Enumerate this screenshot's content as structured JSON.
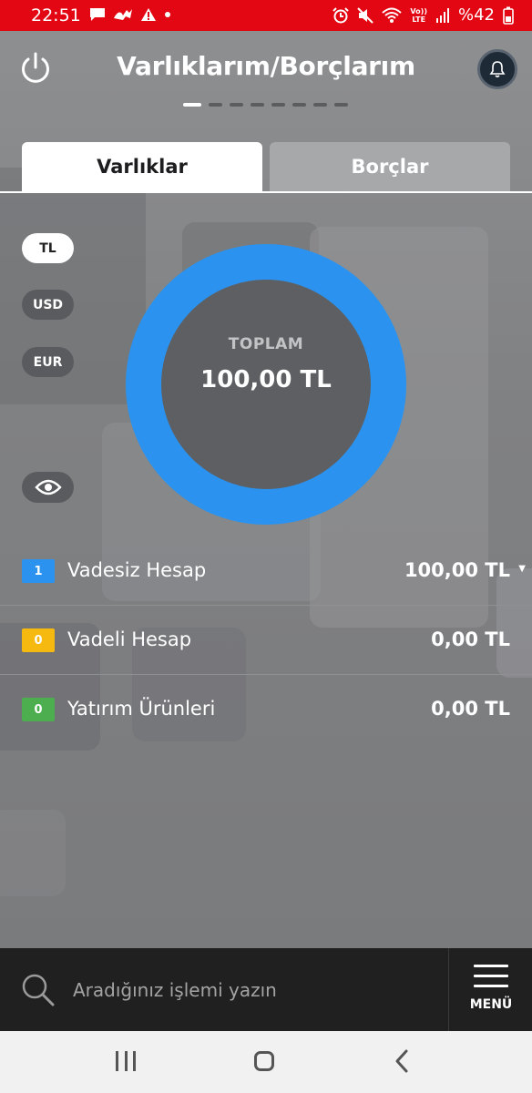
{
  "status_bar": {
    "time": "22:51",
    "battery": "%42",
    "left_icons": [
      "message-icon",
      "animal-icon",
      "warning-icon",
      "dot-icon"
    ],
    "right_icons": [
      "alarm-icon",
      "mute-icon",
      "wifi-icon",
      "volte-icon",
      "signal-icon",
      "battery-icon"
    ],
    "volte_top": "Vo))",
    "volte_bottom": "LTE",
    "color": "#e30613"
  },
  "header": {
    "title": "Varlıklarım/Borçlarım",
    "power_icon": "power-icon",
    "bell_icon": "bell-icon",
    "page_dots_count": 8,
    "active_dot": 0
  },
  "tabs": [
    {
      "label": "Varlıklar",
      "active": true
    },
    {
      "label": "Borçlar",
      "active": false
    }
  ],
  "currencies": [
    {
      "label": "TL",
      "selected": true
    },
    {
      "label": "USD",
      "selected": false
    },
    {
      "label": "EUR",
      "selected": false
    }
  ],
  "visibility_toggle": {
    "icon": "eye-icon"
  },
  "summary": {
    "label": "TOPLAM",
    "value": "100,00 TL",
    "ring_color": "#2b93ef"
  },
  "accounts": [
    {
      "count": "1",
      "name": "Vadesiz Hesap",
      "amount": "100,00 TL",
      "badge_color": "#2b93ef",
      "expandable": true
    },
    {
      "count": "0",
      "name": "Vadeli Hesap",
      "amount": "0,00 TL",
      "badge_color": "#f5b90f",
      "expandable": false
    },
    {
      "count": "0",
      "name": "Yatırım Ürünleri",
      "amount": "0,00 TL",
      "badge_color": "#4cae4f",
      "expandable": false
    }
  ],
  "search": {
    "placeholder": "Aradığınız işlemi yazın",
    "value": ""
  },
  "menu": {
    "label": "MENÜ"
  },
  "nav": {
    "icons": [
      "recent-apps-icon",
      "home-icon",
      "back-icon"
    ]
  }
}
